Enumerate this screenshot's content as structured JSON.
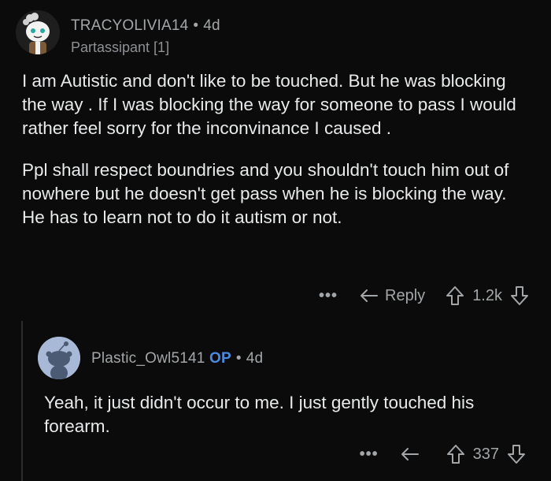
{
  "comment1": {
    "username": "TRACYOLIVIA14",
    "separator": "•",
    "age": "4d",
    "flair": "Partassipant [1]",
    "paragraph1": "I am Autistic and don't like to be touched. But he was blocking the way . If I was blocking the way for someone to pass I would rather feel sorry for the inconvinance I caused .",
    "paragraph2": "Ppl shall respect boundries and you shouldn't touch him out of nowhere but he doesn't get pass when he is blocking the way. He has to learn not to do it autism or not.",
    "more": "•••",
    "reply_label": "Reply",
    "score": "1.2k"
  },
  "comment2": {
    "username": "Plastic_Owl5141",
    "op_badge": "OP",
    "separator": "•",
    "age": "4d",
    "body": "Yeah, it just didn't occur to me.  I just gently touched his forearm.",
    "more": "•••",
    "score": "337"
  },
  "icons": {
    "reply": "reply-arrow-icon",
    "upvote": "upvote-arrow-icon",
    "downvote": "downvote-arrow-icon"
  },
  "colors": {
    "background": "#0b0b0b",
    "text": "#e8eaeb",
    "meta": "#a3a6a8",
    "op": "#4a8be0"
  }
}
